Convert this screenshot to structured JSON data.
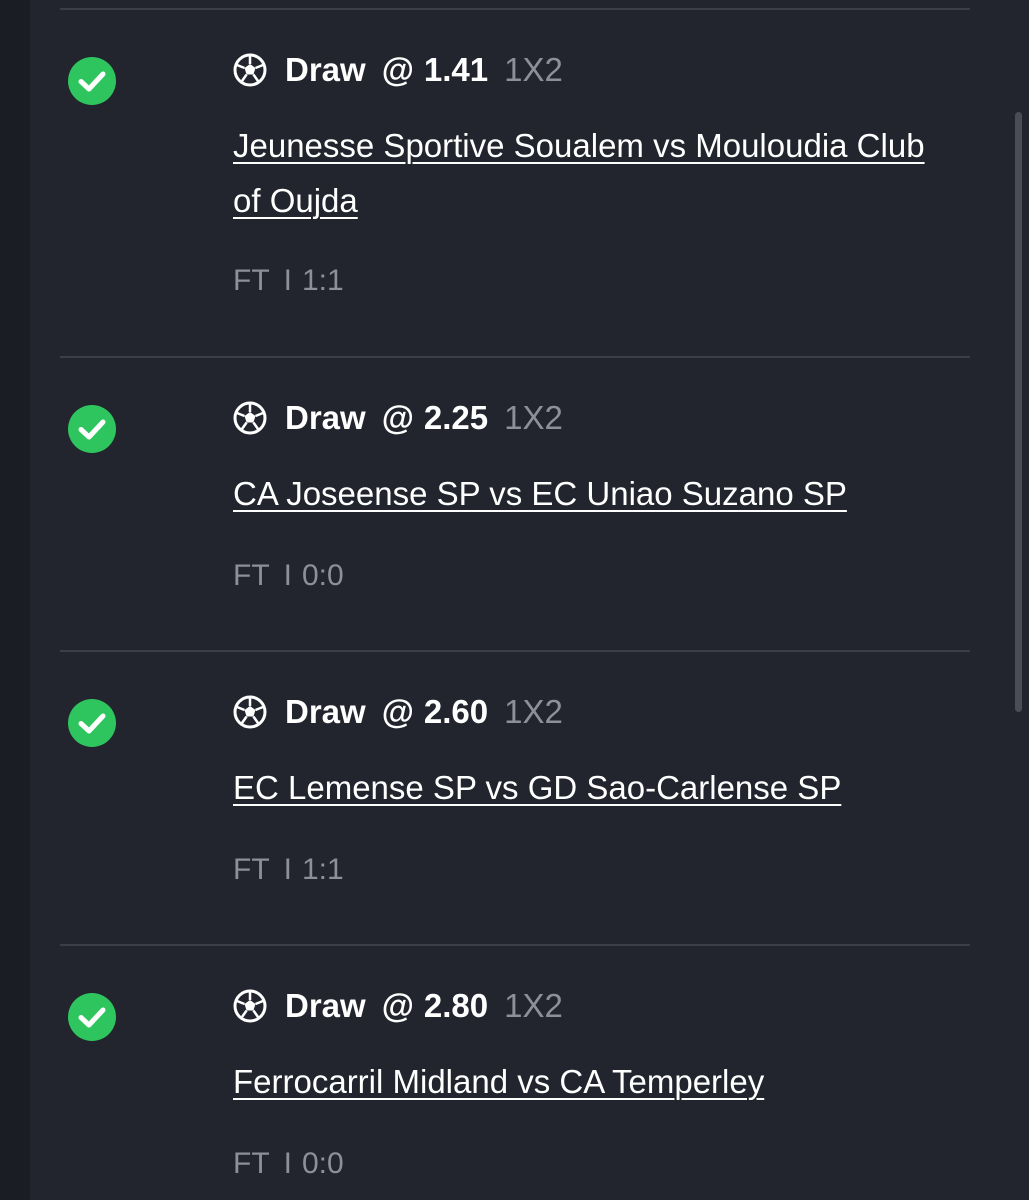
{
  "colors": {
    "background": "#1a1d23",
    "panel": "#22252d",
    "divider": "#3b3e46",
    "success": "#2ec55e",
    "text_primary": "#ffffff",
    "text_secondary": "#8d9099"
  },
  "bets": [
    {
      "status_icon": "check-circle-icon",
      "sport_icon": "soccer-ball-icon",
      "pick": "Draw",
      "at": "@",
      "odds": "1.41",
      "market": "1X2",
      "match": "Jeunesse Sportive Soualem vs Mouloudia Club of Oujda",
      "status": "FT",
      "separator": "I",
      "score": "1:1"
    },
    {
      "status_icon": "check-circle-icon",
      "sport_icon": "soccer-ball-icon",
      "pick": "Draw",
      "at": "@",
      "odds": "2.25",
      "market": "1X2",
      "match": "CA Joseense SP vs EC Uniao Suzano SP",
      "status": "FT",
      "separator": "I",
      "score": "0:0"
    },
    {
      "status_icon": "check-circle-icon",
      "sport_icon": "soccer-ball-icon",
      "pick": "Draw",
      "at": "@",
      "odds": "2.60",
      "market": "1X2",
      "match": "EC Lemense SP vs GD Sao-Carlense SP",
      "status": "FT",
      "separator": "I",
      "score": "1:1"
    },
    {
      "status_icon": "check-circle-icon",
      "sport_icon": "soccer-ball-icon",
      "pick": "Draw",
      "at": "@",
      "odds": "2.80",
      "market": "1X2",
      "match": "Ferrocarril Midland vs CA Temperley",
      "status": "FT",
      "separator": "I",
      "score": "0:0"
    }
  ]
}
